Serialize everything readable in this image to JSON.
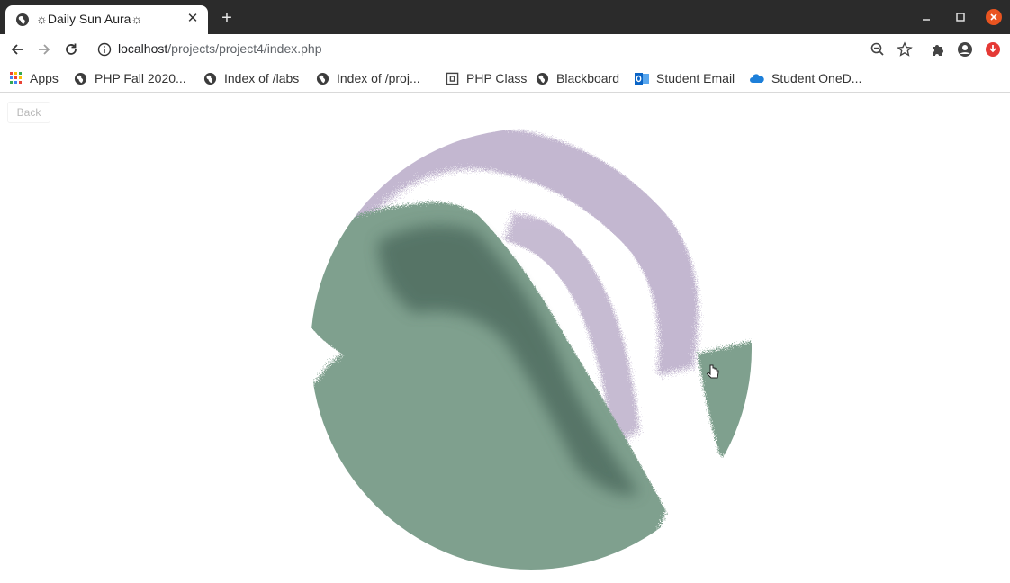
{
  "browser": {
    "tab_title": "☼Daily Sun Aura☼",
    "url_host": "localhost",
    "url_path": "/projects/project4/index.php",
    "bookmarks": [
      {
        "label": "Apps",
        "icon": "apps-grid-icon"
      },
      {
        "label": "PHP Fall 2020...",
        "icon": "globe-icon"
      },
      {
        "label": "Index of /labs",
        "icon": "globe-icon"
      },
      {
        "label": "Index of /proj...",
        "icon": "globe-icon"
      },
      {
        "label": "PHP Class",
        "icon": "document-icon"
      },
      {
        "label": "Blackboard",
        "icon": "globe-icon"
      },
      {
        "label": "Student Email",
        "icon": "outlook-icon"
      },
      {
        "label": "Student OneD...",
        "icon": "onedrive-icon"
      }
    ]
  },
  "page": {
    "back_label": "Back"
  },
  "colors": {
    "aura_green": "#7fa08e",
    "aura_dark_green": "#4f6d60",
    "aura_purple": "#b9abc8",
    "close_button": "#e95420",
    "extension_red": "#e53935"
  }
}
